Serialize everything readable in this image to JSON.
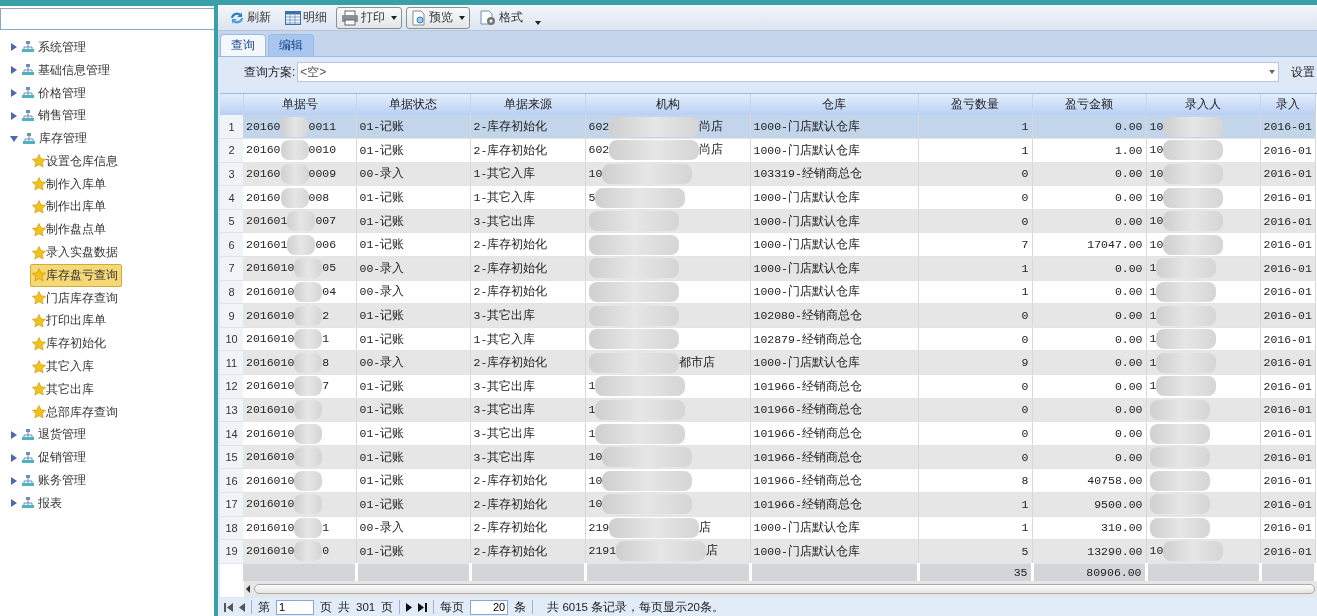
{
  "sidebar": {
    "tree": [
      {
        "label": "系统管理",
        "expanded": false
      },
      {
        "label": "基础信息管理",
        "expanded": false
      },
      {
        "label": "价格管理",
        "expanded": false
      },
      {
        "label": "销售管理",
        "expanded": false
      },
      {
        "label": "库存管理",
        "expanded": true,
        "children": [
          {
            "label": "设置仓库信息",
            "selected": false
          },
          {
            "label": "制作入库单",
            "selected": false
          },
          {
            "label": "制作出库单",
            "selected": false
          },
          {
            "label": "制作盘点单",
            "selected": false
          },
          {
            "label": "录入实盘数据",
            "selected": false
          },
          {
            "label": "库存盘亏查询",
            "selected": true
          },
          {
            "label": "门店库存查询",
            "selected": false
          },
          {
            "label": "打印出库单",
            "selected": false
          },
          {
            "label": "库存初始化",
            "selected": false
          },
          {
            "label": "其它入库",
            "selected": false
          },
          {
            "label": "其它出库",
            "selected": false
          },
          {
            "label": "总部库存查询",
            "selected": false
          }
        ]
      },
      {
        "label": "退货管理",
        "expanded": false
      },
      {
        "label": "促销管理",
        "expanded": false
      },
      {
        "label": "账务管理",
        "expanded": false
      },
      {
        "label": "报表",
        "expanded": false
      }
    ]
  },
  "toolbar": [
    {
      "kind": "refresh",
      "label": "刷新"
    },
    {
      "kind": "detail",
      "label": "明细"
    },
    {
      "kind": "print",
      "label": "打印",
      "dropdown": true
    },
    {
      "kind": "preview",
      "label": "预览",
      "dropdown": true
    },
    {
      "kind": "format",
      "label": "格式"
    }
  ],
  "tabs": [
    {
      "label": "查询",
      "selected": true
    },
    {
      "label": "编辑",
      "selected": false
    }
  ],
  "query": {
    "label": "查询方案:",
    "value": "<空>",
    "settings": "设置"
  },
  "table": {
    "columns": [
      "单据号",
      "单据状态",
      "单据来源",
      "机构",
      "仓库",
      "盈亏数量",
      "盈亏金额",
      "录入人",
      "录入"
    ],
    "rows": [
      {
        "num": "1",
        "selected": true,
        "bill": [
          "20160",
          "0011"
        ],
        "status": "01-记账",
        "source": "2-库存初始化",
        "org": [
          "602",
          "尚店"
        ],
        "warehouse": "1000-门店默认仓库",
        "qty": "1",
        "amount": "0.00",
        "entrant": [
          "10"
        ],
        "date": "2016-01"
      },
      {
        "num": "2",
        "selected": false,
        "bill": [
          "20160",
          "0010"
        ],
        "status": "01-记账",
        "source": "2-库存初始化",
        "org": [
          "602",
          "尚店"
        ],
        "warehouse": "1000-门店默认仓库",
        "qty": "1",
        "amount": "1.00",
        "entrant": [
          "10"
        ],
        "date": "2016-01"
      },
      {
        "num": "3",
        "selected": false,
        "bill": [
          "20160",
          "0009"
        ],
        "status": "00-录入",
        "source": "1-其它入库",
        "org": [
          "10"
        ],
        "warehouse": "103319-经销商总仓",
        "qty": "0",
        "amount": "0.00",
        "entrant": [
          "10"
        ],
        "date": "2016-01"
      },
      {
        "num": "4",
        "selected": false,
        "bill": [
          "20160",
          "008"
        ],
        "status": "01-记账",
        "source": "1-其它入库",
        "org": [
          "5"
        ],
        "warehouse": "1000-门店默认仓库",
        "qty": "0",
        "amount": "0.00",
        "entrant": [
          "10"
        ],
        "date": "2016-01"
      },
      {
        "num": "5",
        "selected": false,
        "bill": [
          "201601",
          "007"
        ],
        "status": "01-记账",
        "source": "3-其它出库",
        "warehouse": "1000-门店默认仓库",
        "qty": "0",
        "amount": "0.00",
        "entrant": [
          "10"
        ],
        "date": "2016-01"
      },
      {
        "num": "6",
        "selected": false,
        "bill": [
          "201601",
          "006"
        ],
        "status": "01-记账",
        "source": "2-库存初始化",
        "warehouse": "1000-门店默认仓库",
        "qty": "7",
        "amount": "17047.00",
        "entrant": [
          "10"
        ],
        "date": "2016-01"
      },
      {
        "num": "7",
        "selected": false,
        "bill": [
          "2016010",
          "05"
        ],
        "status": "00-录入",
        "source": "2-库存初始化",
        "warehouse": "1000-门店默认仓库",
        "qty": "1",
        "amount": "0.00",
        "entrant": [
          "1"
        ],
        "date": "2016-01"
      },
      {
        "num": "8",
        "selected": false,
        "bill": [
          "2016010",
          "04"
        ],
        "status": "00-录入",
        "source": "2-库存初始化",
        "warehouse": "1000-门店默认仓库",
        "qty": "1",
        "amount": "0.00",
        "entrant": [
          "1"
        ],
        "date": "2016-01"
      },
      {
        "num": "9",
        "selected": false,
        "bill": [
          "2016010",
          "2"
        ],
        "status": "01-记账",
        "source": "3-其它出库",
        "warehouse": "102080-经销商总仓",
        "qty": "0",
        "amount": "0.00",
        "entrant": [
          "1"
        ],
        "date": "2016-01"
      },
      {
        "num": "10",
        "selected": false,
        "bill": [
          "2016010",
          "1"
        ],
        "status": "01-记账",
        "source": "1-其它入库",
        "warehouse": "102879-经销商总仓",
        "qty": "0",
        "amount": "0.00",
        "entrant": [
          "1"
        ],
        "date": "2016-01"
      },
      {
        "num": "11",
        "selected": false,
        "bill": [
          "2016010",
          "8"
        ],
        "status": "00-录入",
        "source": "2-库存初始化",
        "org_tail": "都市店",
        "warehouse": "1000-门店默认仓库",
        "qty": "9",
        "amount": "0.00",
        "entrant": [
          "1"
        ],
        "date": "2016-01"
      },
      {
        "num": "12",
        "selected": false,
        "bill": [
          "2016010",
          "7"
        ],
        "status": "01-记账",
        "source": "3-其它出库",
        "org": [
          "1"
        ],
        "warehouse": "101966-经销商总仓",
        "qty": "0",
        "amount": "0.00",
        "entrant": [
          "1"
        ],
        "date": "2016-01"
      },
      {
        "num": "13",
        "selected": false,
        "bill": [
          "2016010"
        ],
        "status": "01-记账",
        "source": "3-其它出库",
        "org": [
          "1"
        ],
        "warehouse": "101966-经销商总仓",
        "qty": "0",
        "amount": "0.00",
        "date": "2016-01"
      },
      {
        "num": "14",
        "selected": false,
        "bill": [
          "2016010"
        ],
        "status": "01-记账",
        "source": "3-其它出库",
        "org": [
          "1"
        ],
        "warehouse": "101966-经销商总仓",
        "qty": "0",
        "amount": "0.00",
        "date": "2016-01"
      },
      {
        "num": "15",
        "selected": false,
        "bill": [
          "2016010"
        ],
        "status": "01-记账",
        "source": "3-其它出库",
        "org": [
          "10"
        ],
        "warehouse": "101966-经销商总仓",
        "qty": "0",
        "amount": "0.00",
        "date": "2016-01"
      },
      {
        "num": "16",
        "selected": false,
        "bill": [
          "2016010"
        ],
        "status": "01-记账",
        "source": "2-库存初始化",
        "org": [
          "10"
        ],
        "warehouse": "101966-经销商总仓",
        "qty": "8",
        "amount": "40758.00",
        "date": "2016-01"
      },
      {
        "num": "17",
        "selected": false,
        "bill": [
          "2016010"
        ],
        "status": "01-记账",
        "source": "2-库存初始化",
        "org": [
          "10"
        ],
        "warehouse": "101966-经销商总仓",
        "qty": "1",
        "amount": "9500.00",
        "date": "2016-01"
      },
      {
        "num": "18",
        "selected": false,
        "bill": [
          "2016010",
          "1"
        ],
        "status": "00-录入",
        "source": "2-库存初始化",
        "org": [
          "219",
          "店"
        ],
        "warehouse": "1000-门店默认仓库",
        "qty": "1",
        "amount": "310.00",
        "date": "2016-01"
      },
      {
        "num": "19",
        "selected": false,
        "bill": [
          "2016010",
          "0"
        ],
        "status": "01-记账",
        "source": "2-库存初始化",
        "org": [
          "2191",
          "店"
        ],
        "warehouse": "1000-门店默认仓库",
        "qty": "5",
        "amount": "13290.00",
        "entrant": [
          "10"
        ],
        "date": "2016-01"
      }
    ],
    "totals": {
      "qty": "35",
      "amount": "80906.00"
    }
  },
  "pager": {
    "page_prefix": "第",
    "page": "1",
    "page_suffix": "页",
    "total_prefix": "共",
    "total_pages": "301",
    "total_suffix": "页",
    "per_page_label": "每页",
    "per_page": "20",
    "per_page_unit": "条",
    "summary": "共 6015 条记录，每页显示20条。"
  }
}
